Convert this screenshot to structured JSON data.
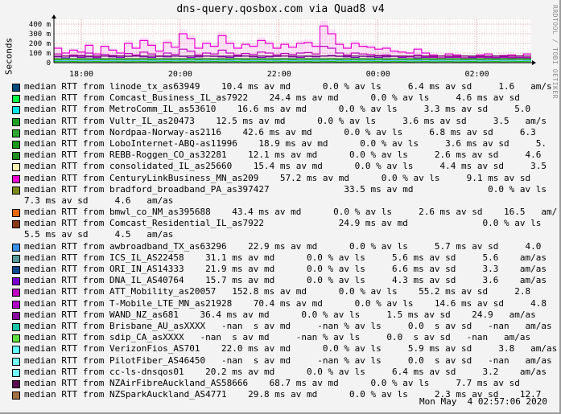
{
  "title": "dns-query.qosbox.com via Quad8 v4",
  "watermark": "RRDTOOL / TOBI OETIKER",
  "timestamp": "Mon May  4 02:57:06 2020",
  "chart_data": {
    "type": "area",
    "ylabel": "Seconds",
    "y_ticks": [
      {
        "value": 0,
        "label": "0"
      },
      {
        "value": 100,
        "label": "100 m"
      },
      {
        "value": 200,
        "label": "200 m"
      },
      {
        "value": 300,
        "label": "300 m"
      },
      {
        "value": 400,
        "label": "400 m"
      }
    ],
    "x_ticks": [
      "18:00",
      "20:00",
      "22:00",
      "00:00",
      "02:00"
    ],
    "ylim": [
      0,
      450
    ],
    "grid": true,
    "series": [
      {
        "name": "CenturyLinkBusiness_MN_as209",
        "color": "#ea00d0",
        "values": [
          150,
          100,
          130,
          110,
          180,
          90,
          170,
          130,
          100,
          200,
          150,
          230,
          180,
          120,
          210,
          160,
          300,
          250,
          150,
          200,
          170,
          280,
          200,
          150,
          190,
          170,
          230,
          200,
          150,
          190,
          160,
          200,
          210,
          170,
          380,
          300,
          190,
          150,
          200,
          170,
          160,
          140,
          150,
          120,
          110,
          100,
          140,
          100,
          80,
          70,
          90,
          80,
          70,
          60,
          80,
          90,
          70,
          75,
          80,
          70,
          90
        ]
      },
      {
        "name": "T-Mobile_LTE_MN_as21928",
        "color": "#8800c8",
        "values": [
          60,
          50,
          65,
          55,
          60,
          50,
          70,
          60,
          55,
          65,
          70,
          60,
          55,
          65,
          60,
          70,
          65,
          55,
          60,
          70,
          65,
          60,
          55,
          65,
          70,
          60,
          55,
          60,
          65,
          70,
          60,
          55,
          65,
          60,
          70,
          75,
          65,
          60,
          55,
          65,
          60,
          55,
          60,
          65,
          55,
          60,
          50,
          55,
          60,
          50,
          55,
          60,
          50,
          55,
          60,
          50,
          55,
          60,
          50,
          55,
          50
        ]
      },
      {
        "name": "ATT_Mobility_as20057",
        "color": "#c000c0",
        "values": [
          90,
          70,
          80,
          75,
          100,
          60,
          85,
          75,
          70,
          95,
          80,
          110,
          90,
          70,
          100,
          85,
          140,
          120,
          80,
          100,
          90,
          130,
          100,
          80,
          95,
          85,
          110,
          100,
          80,
          95,
          85,
          100,
          105,
          90,
          170,
          150,
          100,
          80,
          100,
          90,
          85,
          75,
          80,
          70,
          65,
          60,
          80,
          60,
          55,
          50,
          60,
          55,
          50,
          45,
          55,
          60,
          50,
          52,
          55,
          50,
          55
        ]
      },
      {
        "name": "NZAirFibreAuckland_AS58666",
        "color": "#5a0a50",
        "values": [
          68,
          68,
          69,
          68,
          68,
          69,
          68,
          68,
          69,
          68,
          68,
          69,
          68,
          68,
          69,
          68,
          68,
          69,
          68,
          68,
          69,
          68,
          68,
          69,
          68,
          68,
          69,
          68,
          68,
          69,
          68,
          68,
          69,
          68,
          68,
          69,
          68,
          68,
          69,
          68,
          68,
          69,
          68,
          68,
          69,
          68,
          68,
          69,
          68,
          68,
          69,
          68,
          68,
          69,
          68,
          68,
          69,
          68,
          68,
          69,
          68
        ]
      },
      {
        "name": "Nordpaa-Norway-as2116",
        "color": "#2e8b2e",
        "values": [
          42,
          43,
          42,
          43,
          42,
          43,
          42,
          43,
          42,
          43,
          42,
          43,
          42,
          43,
          42,
          43,
          42,
          43,
          42,
          43,
          42,
          43,
          42,
          43,
          42,
          43,
          42,
          43,
          42,
          43,
          42,
          43,
          42,
          43,
          42,
          43,
          42,
          43,
          42,
          43,
          42,
          43,
          42,
          43,
          42,
          43,
          42,
          43,
          42,
          43,
          42,
          43,
          42,
          43,
          42,
          43,
          42,
          43,
          42,
          43,
          42
        ]
      },
      {
        "name": "ICS_IL_AS22458",
        "color": "#00a000",
        "values": [
          30,
          32,
          31,
          30,
          31,
          32,
          30,
          31,
          32,
          30,
          31,
          32,
          30,
          31,
          32,
          30,
          31,
          32,
          30,
          31,
          32,
          30,
          31,
          32,
          30,
          31,
          32,
          30,
          31,
          32,
          30,
          31,
          32,
          30,
          31,
          32,
          30,
          31,
          32,
          30,
          31,
          32,
          30,
          31,
          32,
          30,
          31,
          32,
          30,
          31,
          32,
          30,
          31,
          32,
          30,
          31,
          32,
          30,
          31,
          32,
          31
        ]
      },
      {
        "name": "linode_tx_as63949",
        "color": "#14bc14",
        "values": [
          12,
          11,
          12,
          10,
          11,
          12,
          10,
          11,
          12,
          10,
          11,
          12,
          10,
          11,
          12,
          10,
          11,
          12,
          10,
          11,
          12,
          10,
          11,
          12,
          10,
          11,
          12,
          10,
          11,
          12,
          10,
          11,
          12,
          10,
          11,
          12,
          10,
          11,
          12,
          10,
          11,
          12,
          10,
          11,
          12,
          10,
          11,
          12,
          10,
          11,
          12,
          10,
          11,
          12,
          10,
          11,
          12,
          10,
          11,
          12,
          11
        ]
      },
      {
        "name": "VerizonFios_AS701",
        "color": "#60c8ff",
        "values": [
          22,
          22,
          23,
          22,
          22,
          23,
          22,
          22,
          23,
          22,
          22,
          23,
          22,
          22,
          23,
          22,
          22,
          23,
          22,
          22,
          23,
          22,
          22,
          23,
          22,
          22,
          23,
          22,
          22,
          23,
          22,
          22,
          23,
          22,
          22,
          23,
          22,
          22,
          23,
          22,
          22,
          23,
          22,
          22,
          23,
          22,
          22,
          23,
          22,
          22,
          23,
          22,
          22,
          23,
          22,
          22,
          23,
          22,
          22,
          23,
          22
        ]
      }
    ]
  },
  "legend": [
    {
      "color": "#004a7c",
      "text": "median RTT from linode_tx_as63949    10.4 ms av md      0.0 % av ls     6.4 ms av sd     1.6   am/s"
    },
    {
      "color": "#00ff44",
      "text": "median RTT from Comcast_Business_IL_as7922    24.4 ms av md      0.0 % av ls     4.6 ms av sd"
    },
    {
      "color": "#00e6e6",
      "text": "median RTT from MetroComm_IL_as53610    16.6 ms av md      0.0 % av ls     3.3 ms av sd     5.0"
    },
    {
      "color": "#20a020",
      "text": "median RTT from Vultr_IL_as20473    12.5 ms av md      0.0 % av ls     3.6 ms av sd     3.5   am/s"
    },
    {
      "color": "#2ea82e",
      "text": "median RTT from Nordpaa-Norway-as2116    42.6 ms av md      0.0 % av ls     6.8 ms av sd     6.3"
    },
    {
      "color": "#1a9a1a",
      "text": "median RTT from LoboInternet-ABQ-as11996    18.9 ms av md      0.0 % av ls     3.6 ms av sd     5."
    },
    {
      "color": "#1f8f1f",
      "text": "median RTT from REBB-Roggen_CO_as32281    12.1 ms av md      0.0 % av ls     2.6 ms av sd     4.6"
    },
    {
      "color": "#ffefb0",
      "text": "median RTT from consolidated_IL_as25660    15.4 ms av md      0.0 % av ls     4.4 ms av sd     3.5"
    },
    {
      "color": "#ea00d0",
      "text": "median RTT from CenturyLinkBusiness_MN_as209    57.2 ms av md      0.0 % av ls     9.1 ms av sd"
    },
    {
      "color": "#7c8a1c",
      "text": "median RTT from bradford_broadband_PA_as397427              33.5 ms av md              0.0 % av ls",
      "cont": "7.3 ms av sd     4.6   am/as"
    },
    {
      "color": "#f06a0a",
      "text": "median RTT from bmwl_co_NM_as395688    43.4 ms av md      0.0 % av ls     2.6 ms av sd    16.5   am/"
    },
    {
      "color": "#8a3a1a",
      "text": "median RTT from Comcast_Residential_IL_as7922              24.9 ms av md              0.0 % av ls",
      "cont": "5.5 ms av sd     4.5   am/as"
    },
    {
      "color": "#3a90ea",
      "text": "median RTT from awbroadband_TX_as63296    22.9 ms av md      0.0 % av ls     5.7 ms av sd     4.0"
    },
    {
      "color": "#5a9a9a",
      "text": "median RTT from ICS_IL_AS22458    31.1 ms av md      0.0 % av ls     5.6 ms av sd     5.6    am/as"
    },
    {
      "color": "#0a4a8a",
      "text": "median RTT from ORI_IN_AS14333    21.9 ms av md      0.0 % av ls     6.6 ms av sd     3.3    am/as"
    },
    {
      "color": "#7a00d0",
      "text": "median RTT from DNA_IL_AS40764    15.7 ms av md      0.0 % av ls     4.3 ms av sd     3.6    am/as"
    },
    {
      "color": "#c000c0",
      "text": "median RTT from ATT_Mobility_as20057   152.8 ms av md      0.0 % av ls    55.2 ms av sd     2.8"
    },
    {
      "color": "#b000c8",
      "text": "median RTT from T-Mobile_LTE_MN_as21928    70.4 ms av md      0.0 % av ls    14.6 ms av sd     4.8"
    },
    {
      "color": "#8a0aa0",
      "text": "median RTT from WAND_NZ_as681    36.4 ms av md      0.0 % av ls     1.5 ms av sd    24.9   am/as"
    },
    {
      "color": "#1ac6a6",
      "text": "median RTT from Brisbane_AU_asXXXX   -nan  s av md     -nan % av ls     0.0  s av sd   -nan   am/as"
    },
    {
      "color": "#60e040",
      "text": "median RTT from sdip_CA_asXXXX   -nan  s av md     -nan % av ls     0.0  s av sd   -nan   am/as"
    },
    {
      "color": "#60ffff",
      "text": "median RTT from VerizonFios_AS701    22.0 ms av md      0.0 % av ls     5.9 ms av sd     3.8   am/as"
    },
    {
      "color": "#70fff0",
      "text": "median RTT from PilotFiber_AS46450   -nan  s av md     -nan % av ls     0.0  s av sd   -nan   am/as"
    },
    {
      "color": "#70ffff",
      "text": "median RTT from cc-ls-dnsqos01    20.2 ms av md      0.0 % av ls     6.4 ms av sd     3.2    am/as"
    },
    {
      "color": "#5a0a50",
      "text": "median RTT from NZAirFibreAuckland_AS58666    68.7 ms av md      0.0 % av ls     7.7 ms av sd"
    },
    {
      "color": "#a07040",
      "text": "median RTT from NZSparkAuckland_AS4771    29.8 ms av md      0.0 % av ls     2.3 ms av sd    12.7"
    }
  ]
}
